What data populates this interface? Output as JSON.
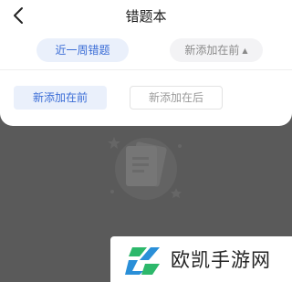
{
  "header": {
    "title": "错题本",
    "back_icon": "chevron-left-icon"
  },
  "filters": {
    "range_label": "近一周错题",
    "sort_label": "新添加在前",
    "sort_caret": "▲"
  },
  "sort_sheet": {
    "options": [
      {
        "label": "新添加在前",
        "selected": true
      },
      {
        "label": "新添加在后",
        "selected": false
      }
    ]
  },
  "empty_state": {
    "icon": "document-stack-icon"
  },
  "watermark": {
    "text": "欧凯手游网",
    "logo_icon": "brand-logo-icon"
  },
  "colors": {
    "accent": "#3b6dd6",
    "accent_bg": "#eaf0fb",
    "overlay": "#5a5a5a"
  }
}
